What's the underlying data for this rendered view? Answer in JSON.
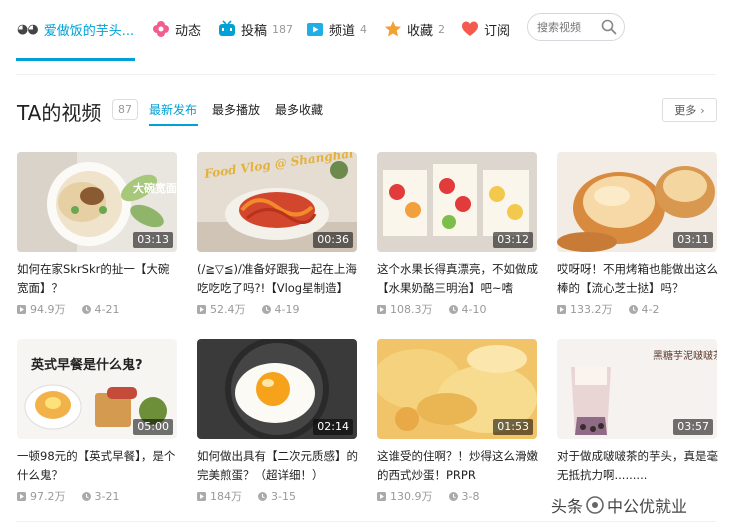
{
  "nav": {
    "user_icon": "eyes-icon",
    "user_name": "爱做饭的芋头...",
    "items": [
      {
        "label": "动态",
        "count": "",
        "icon": "flower-icon",
        "color": "#f25d8e"
      },
      {
        "label": "投稿",
        "count": "187",
        "icon": "tv-icon",
        "color": "#00a1d6"
      },
      {
        "label": "频道",
        "count": "4",
        "icon": "play-folder-icon",
        "color": "#23ade5"
      },
      {
        "label": "收藏",
        "count": "2",
        "icon": "star-badge-icon",
        "color": "#f3a034"
      },
      {
        "label": "订阅",
        "count": "",
        "icon": "heart-icon",
        "color": "#f45a4e"
      }
    ],
    "search_placeholder": "搜索视频"
  },
  "section": {
    "title": "TA的视频",
    "count": "87",
    "sort_tabs": [
      "最新发布",
      "最多播放",
      "最多收藏"
    ],
    "more_label": "更多"
  },
  "videos": [
    {
      "title": "如何在家SkrSkr的扯一【大碗宽面】？",
      "duration": "03:13",
      "views": "94.9万",
      "date": "4-21",
      "thumb_text": "大碗宽面"
    },
    {
      "title": "(/≧▽≦)/准备好跟我一起在上海吃吃吃了吗?!【Vlog星制造】",
      "duration": "00:36",
      "views": "52.4万",
      "date": "4-19",
      "thumb_text": "Food Vlog @ Shanghai"
    },
    {
      "title": "这个水果长得真漂亮，不如做成【水果奶酪三明治】吧~嗜",
      "duration": "03:12",
      "views": "108.3万",
      "date": "4-10",
      "thumb_text": ""
    },
    {
      "title": "哎呀呀！不用烤箱也能做出这么棒的【流心芝士挞】吗？",
      "duration": "03:11",
      "views": "133.2万",
      "date": "4-2",
      "thumb_text": ""
    },
    {
      "title": "一顿98元的【英式早餐】，是个什么鬼？",
      "duration": "05:00",
      "views": "97.2万",
      "date": "3-21",
      "thumb_text": "英式早餐是什么鬼?"
    },
    {
      "title": "如何做出具有【二次元质感】的完美煎蛋？（超详细！）",
      "duration": "02:14",
      "views": "184万",
      "date": "3-15",
      "thumb_text": ""
    },
    {
      "title": "这谁受的住啊？！炒得这么滑嫩的西式炒蛋！PRPR",
      "duration": "01:53",
      "views": "130.9万",
      "date": "3-8",
      "thumb_text": ""
    },
    {
      "title": "对于做成啵啵茶的芋头，真是毫无抵抗力啊.........",
      "duration": "03:57",
      "views": "",
      "date": "",
      "thumb_text": "黑糖芋泥啵啵茶"
    }
  ],
  "watermark": {
    "prefix": "头条",
    "text": "中公优就业"
  }
}
